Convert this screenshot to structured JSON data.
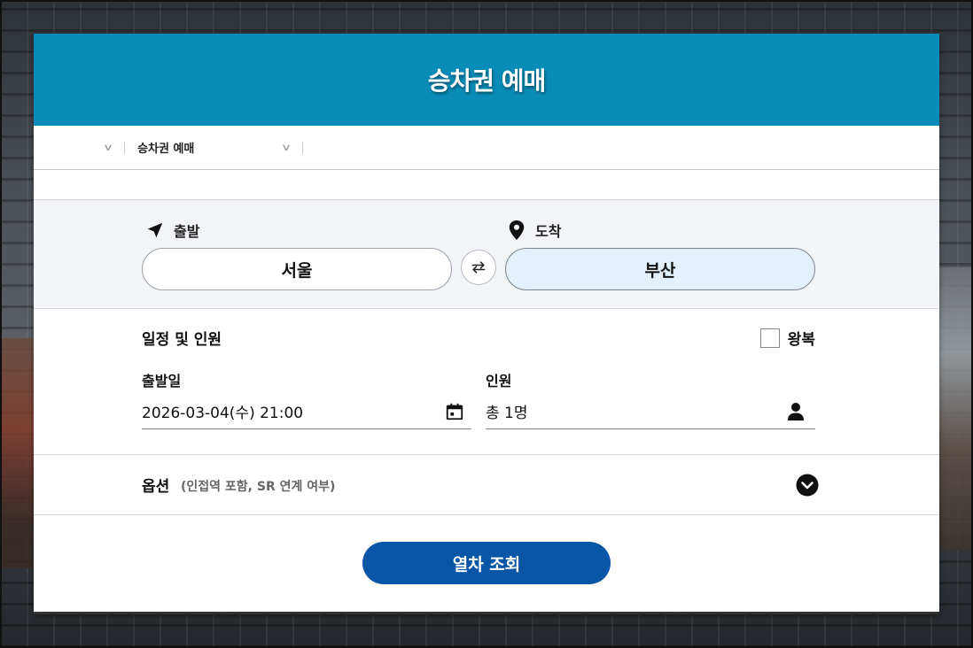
{
  "header": {
    "title": "승차권 예매"
  },
  "breadcrumb": {
    "current": "승차권 예매"
  },
  "route": {
    "departure_label": "출발",
    "arrival_label": "도착",
    "departure_station": "서울",
    "arrival_station": "부산"
  },
  "schedule": {
    "section_title": "일정 및 인원",
    "roundtrip_label": "왕복",
    "roundtrip_checked": false,
    "date_label": "출발일",
    "date_value": "2026-03-04(수) 21:00",
    "passenger_label": "인원",
    "passenger_value": "총 1명"
  },
  "options": {
    "title": "옵션",
    "subtitle": "(인접역 포함, SR 연계 여부)"
  },
  "search_button": {
    "label": "열차 조회"
  },
  "colors": {
    "header_bg": "#0a8cb8",
    "search_button": "#0a56a6",
    "arrival_highlight": "#e3f1fc"
  },
  "icons": {
    "departure": "navigation-arrow-icon",
    "arrival": "location-pin-icon",
    "swap": "swap-arrows-icon",
    "calendar": "calendar-icon",
    "person": "person-icon",
    "options_toggle": "chevron-down-circle-icon"
  }
}
